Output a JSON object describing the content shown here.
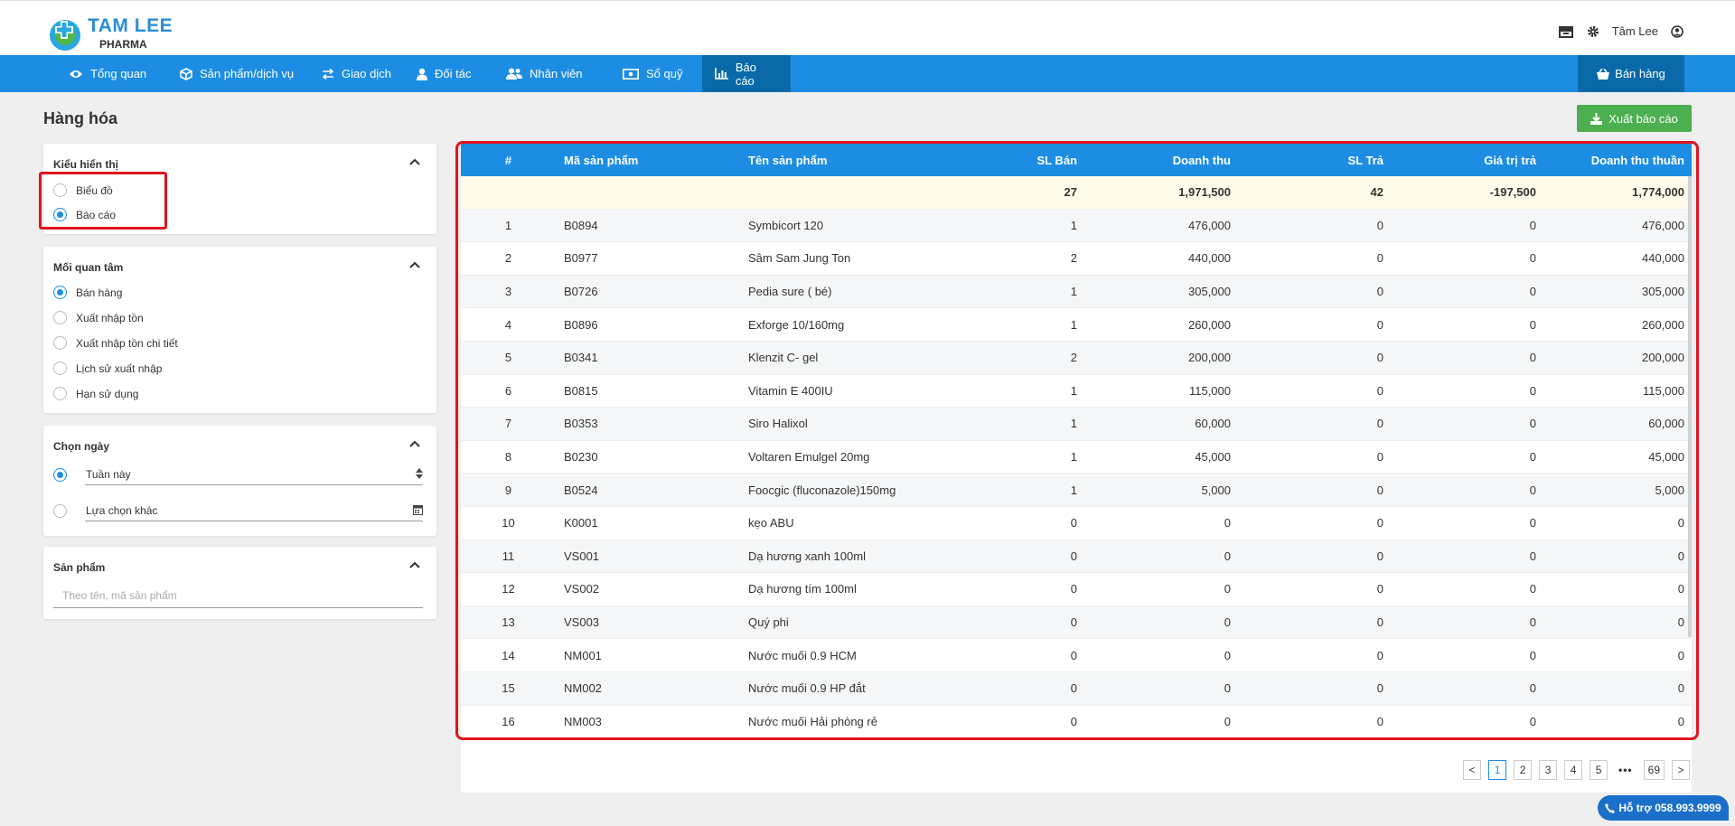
{
  "brand": {
    "name": "TAM LEE",
    "sub": "PHARMA"
  },
  "user": {
    "name": "Tâm Lee"
  },
  "nav": {
    "items": [
      {
        "label": "Tổng quan"
      },
      {
        "label": "Sản phẩm/dịch vụ"
      },
      {
        "label": "Giao dịch"
      },
      {
        "label": "Đối tác"
      },
      {
        "label": "Nhân viên"
      },
      {
        "label": "Sổ quỹ"
      },
      {
        "label": "Báo cáo"
      }
    ],
    "sell": "Bán hàng"
  },
  "page": {
    "title": "Hàng hóa",
    "export": "Xuất báo cáo"
  },
  "filters": {
    "display": {
      "title": "Kiểu hiển thị",
      "options": [
        "Biểu đồ",
        "Báo cáo"
      ],
      "selected": "Báo cáo"
    },
    "concern": {
      "title": "Mối quan tâm",
      "options": [
        "Bán hàng",
        "Xuất nhập tồn",
        "Xuất nhập tồn chi tiết",
        "Lịch sử xuất nhập",
        "Hạn sử dụng"
      ],
      "selected": "Bán hàng"
    },
    "date": {
      "title": "Chọn ngày",
      "preset": "Tuần này",
      "custom": "Lựa chọn khác"
    },
    "product": {
      "title": "Sản phẩm",
      "placeholder": "Theo tên, mã sản phẩm"
    }
  },
  "table": {
    "headers": [
      "#",
      "Mã sản phẩm",
      "Tên sản phẩm",
      "SL Bán",
      "Doanh thu",
      "SL Trả",
      "Giá trị trả",
      "Doanh thu thuần"
    ],
    "summary": {
      "sl_ban": "27",
      "doanh_thu": "1,971,500",
      "sl_tra": "42",
      "gia_tri_tra": "-197,500",
      "doanh_thu_thuan": "1,774,000"
    },
    "rows": [
      {
        "idx": "1",
        "code": "B0894",
        "name": "Symbicort 120",
        "sl_ban": "1",
        "doanh_thu": "476,000",
        "sl_tra": "0",
        "gia_tri_tra": "0",
        "doanh_thu_thuan": "476,000"
      },
      {
        "idx": "2",
        "code": "B0977",
        "name": "Sâm Sam Jung Ton",
        "sl_ban": "2",
        "doanh_thu": "440,000",
        "sl_tra": "0",
        "gia_tri_tra": "0",
        "doanh_thu_thuan": "440,000"
      },
      {
        "idx": "3",
        "code": "B0726",
        "name": "Pedia sure ( bé)",
        "sl_ban": "1",
        "doanh_thu": "305,000",
        "sl_tra": "0",
        "gia_tri_tra": "0",
        "doanh_thu_thuan": "305,000"
      },
      {
        "idx": "4",
        "code": "B0896",
        "name": "Exforge 10/160mg",
        "sl_ban": "1",
        "doanh_thu": "260,000",
        "sl_tra": "0",
        "gia_tri_tra": "0",
        "doanh_thu_thuan": "260,000"
      },
      {
        "idx": "5",
        "code": "B0341",
        "name": "Klenzit C- gel",
        "sl_ban": "2",
        "doanh_thu": "200,000",
        "sl_tra": "0",
        "gia_tri_tra": "0",
        "doanh_thu_thuan": "200,000"
      },
      {
        "idx": "6",
        "code": "B0815",
        "name": "Vitamin E 400IU",
        "sl_ban": "1",
        "doanh_thu": "115,000",
        "sl_tra": "0",
        "gia_tri_tra": "0",
        "doanh_thu_thuan": "115,000"
      },
      {
        "idx": "7",
        "code": "B0353",
        "name": "Siro Halixol",
        "sl_ban": "1",
        "doanh_thu": "60,000",
        "sl_tra": "0",
        "gia_tri_tra": "0",
        "doanh_thu_thuan": "60,000"
      },
      {
        "idx": "8",
        "code": "B0230",
        "name": "Voltaren Emulgel 20mg",
        "sl_ban": "1",
        "doanh_thu": "45,000",
        "sl_tra": "0",
        "gia_tri_tra": "0",
        "doanh_thu_thuan": "45,000"
      },
      {
        "idx": "9",
        "code": "B0524",
        "name": "Foocgic (fluconazole)150mg",
        "sl_ban": "1",
        "doanh_thu": "5,000",
        "sl_tra": "0",
        "gia_tri_tra": "0",
        "doanh_thu_thuan": "5,000"
      },
      {
        "idx": "10",
        "code": "K0001",
        "name": "kẹo ABU",
        "sl_ban": "0",
        "doanh_thu": "0",
        "sl_tra": "0",
        "gia_tri_tra": "0",
        "doanh_thu_thuan": "0"
      },
      {
        "idx": "11",
        "code": "VS001",
        "name": "Dạ hương xanh 100ml",
        "sl_ban": "0",
        "doanh_thu": "0",
        "sl_tra": "0",
        "gia_tri_tra": "0",
        "doanh_thu_thuan": "0"
      },
      {
        "idx": "12",
        "code": "VS002",
        "name": "Dạ hương tím 100ml",
        "sl_ban": "0",
        "doanh_thu": "0",
        "sl_tra": "0",
        "gia_tri_tra": "0",
        "doanh_thu_thuan": "0"
      },
      {
        "idx": "13",
        "code": "VS003",
        "name": "Quý phi",
        "sl_ban": "0",
        "doanh_thu": "0",
        "sl_tra": "0",
        "gia_tri_tra": "0",
        "doanh_thu_thuan": "0"
      },
      {
        "idx": "14",
        "code": "NM001",
        "name": "Nước muối 0.9 HCM",
        "sl_ban": "0",
        "doanh_thu": "0",
        "sl_tra": "0",
        "gia_tri_tra": "0",
        "doanh_thu_thuan": "0"
      },
      {
        "idx": "15",
        "code": "NM002",
        "name": "Nước muối 0.9 HP đắt",
        "sl_ban": "0",
        "doanh_thu": "0",
        "sl_tra": "0",
        "gia_tri_tra": "0",
        "doanh_thu_thuan": "0"
      },
      {
        "idx": "16",
        "code": "NM003",
        "name": "Nước muối Hải phòng rẻ",
        "sl_ban": "0",
        "doanh_thu": "0",
        "sl_tra": "0",
        "gia_tri_tra": "0",
        "doanh_thu_thuan": "0"
      }
    ]
  },
  "pagination": {
    "prev": "<",
    "pages": [
      "1",
      "2",
      "3",
      "4",
      "5"
    ],
    "dots": "•••",
    "last": "69",
    "next": ">",
    "current": "1"
  },
  "support": {
    "label": "Hỗ trợ 058.993.9999"
  },
  "colors": {
    "primary": "#1c8de3",
    "primary_dark": "#0a6aa9",
    "success": "#4caf50",
    "highlight": "#e0141e",
    "summary_bg": "#fefbea"
  }
}
